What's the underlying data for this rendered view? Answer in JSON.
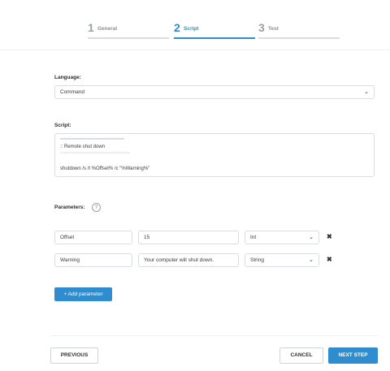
{
  "steps": [
    {
      "number": "1",
      "label": "General",
      "state": "done"
    },
    {
      "number": "2",
      "label": "Script",
      "state": "active"
    },
    {
      "number": "3",
      "label": "Test",
      "state": "upcoming"
    }
  ],
  "language": {
    "label": "Language:",
    "value": "Command"
  },
  "script": {
    "label": "Script:",
    "lines": [
      "==============================",
      ":: Remote shut down",
      "::~~~~~~~~~~~~~~~~~~~~~~~~~~~~~~~~",
      "",
      "shutdown /s /t %Offset% /c \"%Warning%\""
    ]
  },
  "parameters": {
    "label": "Parameters:",
    "help": "?",
    "rows": [
      {
        "name": "Offset",
        "value": "15",
        "type": "Int"
      },
      {
        "name": "Warning",
        "value": "Your computer will shut down.",
        "type": "String"
      }
    ],
    "add_label": "+ Add parameter"
  },
  "footer": {
    "previous": "PREVIOUS",
    "cancel": "CANCEL",
    "next": "NEXT STEP"
  },
  "colors": {
    "accent": "#2f8ccf",
    "border": "#d9dde2"
  }
}
